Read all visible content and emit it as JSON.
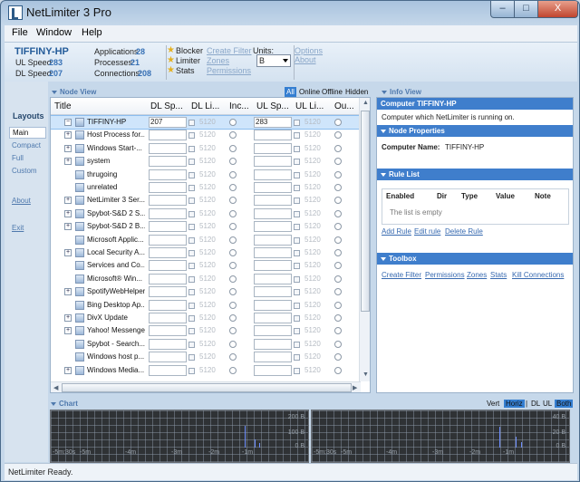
{
  "window": {
    "title": "NetLimiter 3 Pro",
    "icon": "netlimiter-logo-icon",
    "min": "–",
    "max": "□",
    "close": "X"
  },
  "menu": {
    "items": [
      "File",
      "Window",
      "Help"
    ]
  },
  "stats": {
    "hostname": "TIFFINY-HP",
    "ul_speed_label": "UL Speed:",
    "ul_speed": "283",
    "dl_speed_label": "DL Speed:",
    "dl_speed": "207",
    "applications_label": "Applications:",
    "applications": "28",
    "processes_label": "Processes:",
    "processes": "21",
    "connections_label": "Connections:",
    "connections": "208",
    "features": [
      "Blocker",
      "Limiter",
      "Stats"
    ],
    "links": [
      "Create Filter",
      "Zones",
      "Permissions"
    ],
    "units_label": "Units:",
    "units_value": "B",
    "right_links": [
      "Options",
      "About"
    ]
  },
  "sidebar": {
    "heading": "Layouts",
    "items": [
      "Main",
      "Compact",
      "Full",
      "Custom"
    ],
    "about": "About",
    "exit": "Exit"
  },
  "node_view": {
    "title": "Node View",
    "modes": [
      "All",
      "Online",
      "Offline",
      "Hidden"
    ],
    "columns": [
      "Title",
      "DL Sp...",
      "DL Li...",
      "Inc...",
      "UL Sp...",
      "UL Li...",
      "Ou..."
    ],
    "rows": [
      {
        "title": "TIFFINY-HP",
        "dl": "207",
        "dl_limit": "5120",
        "ul": "283",
        "ul_limit": "5120",
        "expander": "−"
      },
      {
        "title": "Host Process for...",
        "dl": "",
        "dl_limit": "5120",
        "ul": "",
        "ul_limit": "5120",
        "expander": "+"
      },
      {
        "title": "Windows Start-...",
        "dl": "",
        "dl_limit": "5120",
        "ul": "",
        "ul_limit": "5120",
        "expander": "+"
      },
      {
        "title": "system",
        "dl": "",
        "dl_limit": "5120",
        "ul": "",
        "ul_limit": "5120",
        "expander": "+"
      },
      {
        "title": "thrugoing",
        "dl": "",
        "dl_limit": "5120",
        "ul": "",
        "ul_limit": "5120",
        "expander": ""
      },
      {
        "title": "unrelated",
        "dl": "",
        "dl_limit": "5120",
        "ul": "",
        "ul_limit": "5120",
        "expander": ""
      },
      {
        "title": "NetLimiter 3 Ser...",
        "dl": "",
        "dl_limit": "5120",
        "ul": "",
        "ul_limit": "5120",
        "expander": "+"
      },
      {
        "title": "Spybot-S&D 2 S...",
        "dl": "",
        "dl_limit": "5120",
        "ul": "",
        "ul_limit": "5120",
        "expander": "+"
      },
      {
        "title": "Spybot-S&D 2 B...",
        "dl": "",
        "dl_limit": "5120",
        "ul": "",
        "ul_limit": "5120",
        "expander": "+"
      },
      {
        "title": "Microsoft Applic...",
        "dl": "",
        "dl_limit": "5120",
        "ul": "",
        "ul_limit": "5120",
        "expander": ""
      },
      {
        "title": "Local Security A...",
        "dl": "",
        "dl_limit": "5120",
        "ul": "",
        "ul_limit": "5120",
        "expander": "+"
      },
      {
        "title": "Services and Co...",
        "dl": "",
        "dl_limit": "5120",
        "ul": "",
        "ul_limit": "5120",
        "expander": ""
      },
      {
        "title": "Microsoft® Win...",
        "dl": "",
        "dl_limit": "5120",
        "ul": "",
        "ul_limit": "5120",
        "expander": ""
      },
      {
        "title": "SpotifyWebHelper",
        "dl": "",
        "dl_limit": "5120",
        "ul": "",
        "ul_limit": "5120",
        "expander": "+"
      },
      {
        "title": "Bing Desktop Ap...",
        "dl": "",
        "dl_limit": "5120",
        "ul": "",
        "ul_limit": "5120",
        "expander": ""
      },
      {
        "title": "DivX Update",
        "dl": "",
        "dl_limit": "5120",
        "ul": "",
        "ul_limit": "5120",
        "expander": "+"
      },
      {
        "title": "Yahoo! Messenger",
        "dl": "",
        "dl_limit": "5120",
        "ul": "",
        "ul_limit": "5120",
        "expander": "+"
      },
      {
        "title": "Spybot - Search...",
        "dl": "",
        "dl_limit": "5120",
        "ul": "",
        "ul_limit": "5120",
        "expander": ""
      },
      {
        "title": "Windows host p...",
        "dl": "",
        "dl_limit": "5120",
        "ul": "",
        "ul_limit": "5120",
        "expander": ""
      },
      {
        "title": "Windows Media...",
        "dl": "",
        "dl_limit": "5120",
        "ul": "",
        "ul_limit": "5120",
        "expander": "+"
      }
    ]
  },
  "info_view": {
    "title": "Info View",
    "computer_band": "Computer TIFFINY-HP",
    "computer_desc": "Computer which NetLimiter is running on.",
    "node_properties": "Node Properties",
    "computer_name_label": "Computer Name:",
    "computer_name": "TIFFINY-HP",
    "rule_list": "Rule List",
    "rule_columns": [
      "Enabled",
      "Dir",
      "Type",
      "Value",
      "Note"
    ],
    "empty_text": "The list is empty",
    "rule_actions": [
      "Add Rule",
      "Edit rule",
      "Delete Rule"
    ],
    "toolbox": "Toolbox",
    "toolbox_links": [
      "Create Filter",
      "Permissions",
      "Zones",
      "Stats",
      "Kill Connections"
    ]
  },
  "chart": {
    "title": "Chart",
    "modes": [
      "Vert",
      "Horiz",
      "|",
      "DL",
      "UL",
      "Both"
    ],
    "left_y_labels": [
      "200 B",
      "100 B",
      "0 B"
    ],
    "right_y_labels": [
      "40 B",
      "20 B",
      "0 B"
    ],
    "x_labels": [
      "-5m:30s",
      "-5m",
      "-4m",
      "-3m",
      "-2m",
      "-1m"
    ]
  },
  "status": {
    "text": "NetLimiter Ready."
  },
  "colors": {
    "accent": "#3f7ecc",
    "link": "#3669b0",
    "chart_bg": "#2f3235"
  }
}
